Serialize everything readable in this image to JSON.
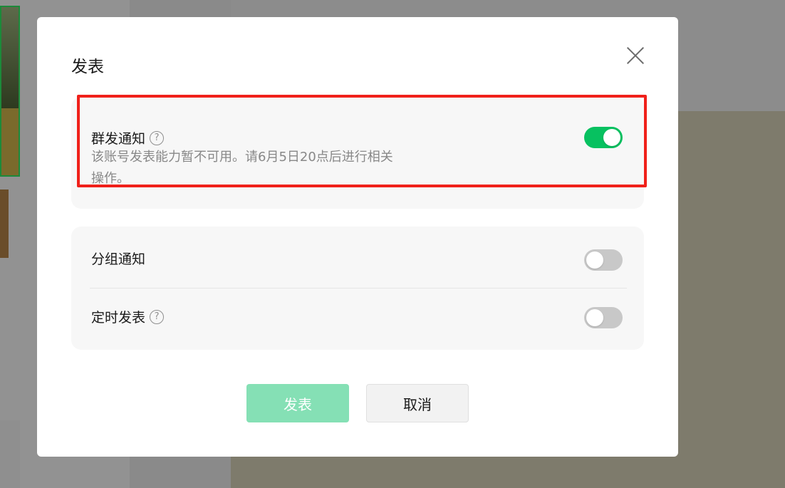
{
  "dialog": {
    "title": "发表",
    "close_icon": "close-icon"
  },
  "mass_notify": {
    "label": "群发通知",
    "help_icon": "question-mark-circle-icon",
    "help_glyph": "?",
    "enabled": true,
    "description_line1": "该账号发表能力暂不可用。请6月5日20点后进行相关",
    "description_line2": "操作。"
  },
  "group_notify": {
    "label": "分组通知",
    "enabled": false
  },
  "scheduled_publish": {
    "label": "定时发表",
    "help_icon": "question-mark-circle-icon",
    "help_glyph": "?",
    "enabled": false
  },
  "buttons": {
    "publish_label": "发表",
    "cancel_label": "取消"
  },
  "colors": {
    "toggle_on": "#07c160",
    "toggle_off": "#c8c8c8",
    "publish_disabled": "#85e0b5",
    "highlight_border": "#f0201a"
  }
}
